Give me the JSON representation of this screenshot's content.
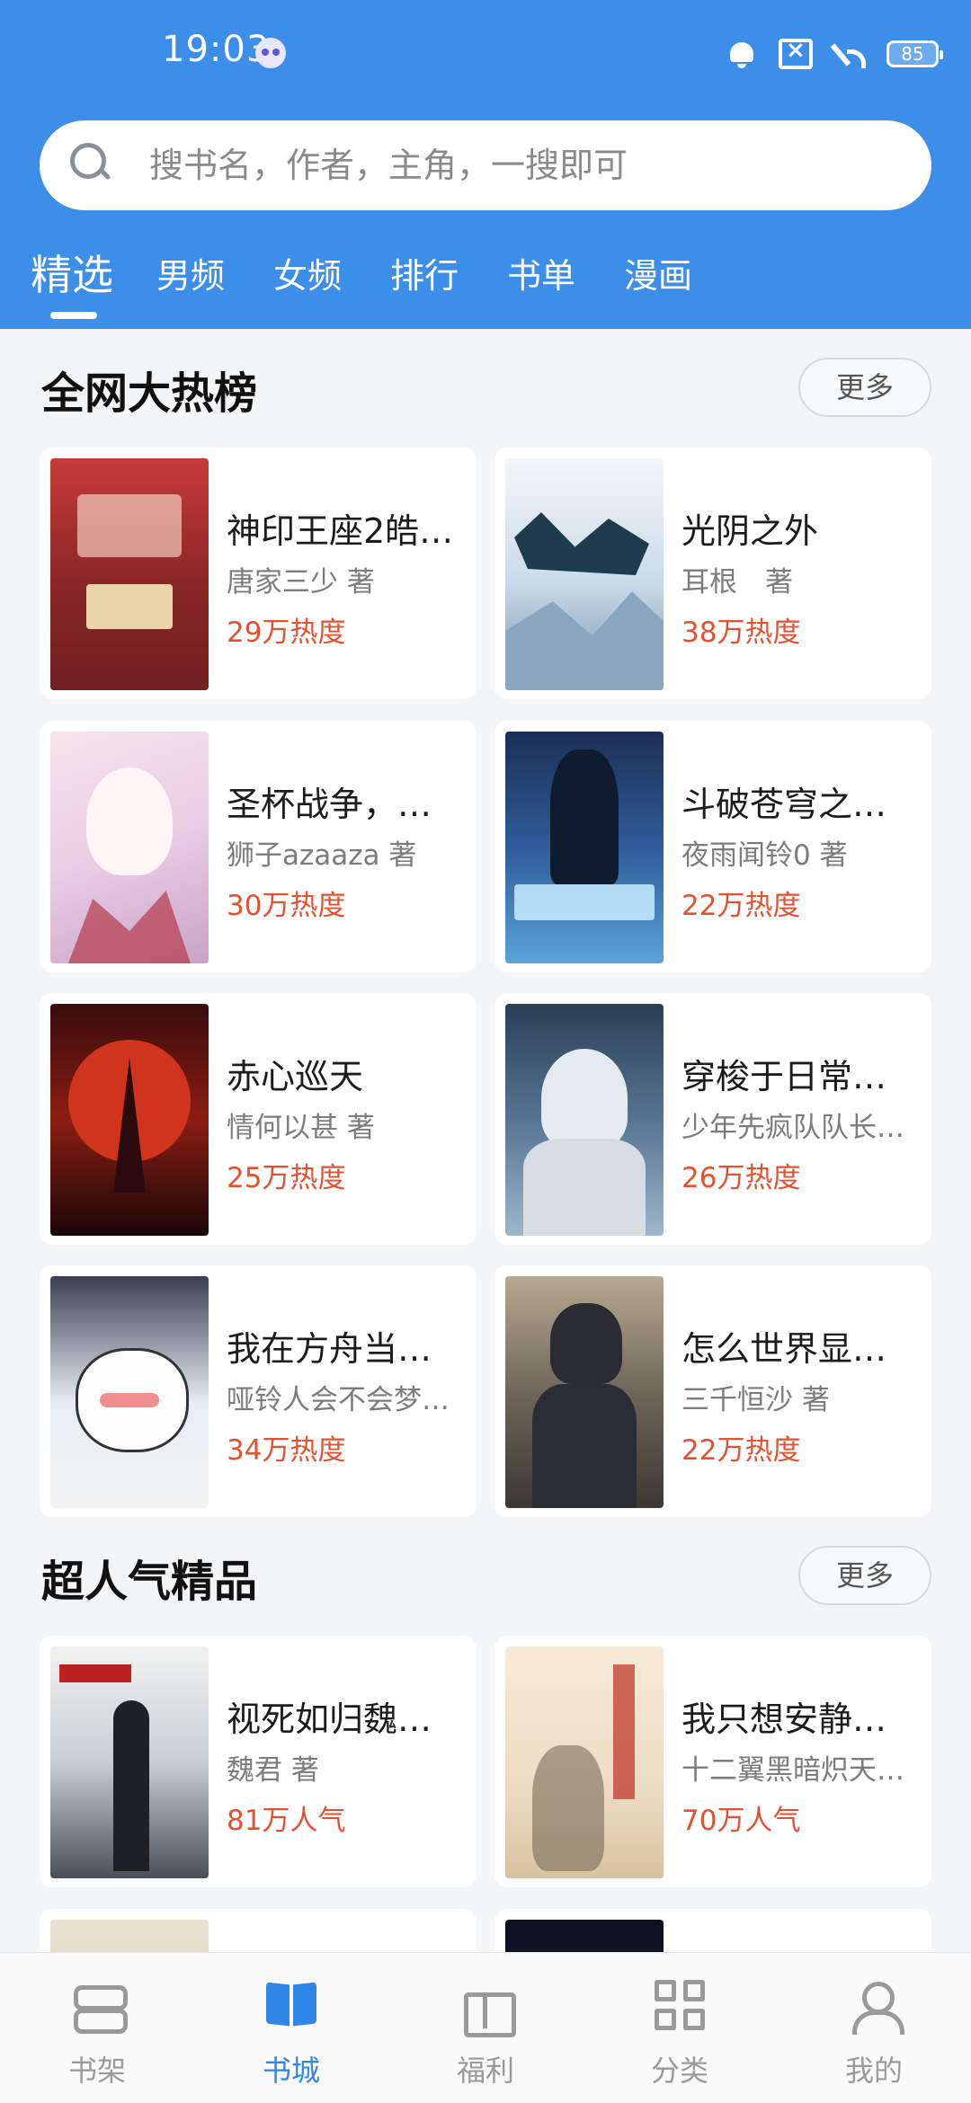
{
  "status_bar": {
    "time": "19:03",
    "battery": "85"
  },
  "search": {
    "placeholder": "搜书名，作者，主角，一搜即可"
  },
  "tabs": [
    "精选",
    "男频",
    "女频",
    "排行",
    "书单",
    "漫画"
  ],
  "sections": [
    {
      "title": "全网大热榜",
      "more_label": "更多",
      "books": [
        {
          "title": "神印王座2皓…",
          "author": "唐家三少 著",
          "stat": "29万热度"
        },
        {
          "title": "光阴之外",
          "author": "耳根　著",
          "stat": "38万热度"
        },
        {
          "title": "圣杯战争，…",
          "author": "狮子azaaza 著",
          "stat": "30万热度"
        },
        {
          "title": "斗破苍穹之…",
          "author": "夜雨闻铃0 著",
          "stat": "22万热度"
        },
        {
          "title": "赤心巡天",
          "author": "情何以甚 著",
          "stat": "25万热度"
        },
        {
          "title": "穿梭于日常…",
          "author": "少年先疯队队长…",
          "stat": "26万热度"
        },
        {
          "title": "我在方舟当…",
          "author": "哑铃人会不会梦…",
          "stat": "34万热度"
        },
        {
          "title": "怎么世界显…",
          "author": "三千恒沙 著",
          "stat": "22万热度"
        }
      ]
    },
    {
      "title": "超人气精品",
      "more_label": "更多",
      "books": [
        {
          "title": "视死如归魏…",
          "author": "魏君 著",
          "stat": "81万人气"
        },
        {
          "title": "我只想安静…",
          "author": "十二翼黑暗炽天…",
          "stat": "70万人气"
        }
      ]
    }
  ],
  "bottom_nav": [
    {
      "label": "书架",
      "icon": "bookshelf-icon"
    },
    {
      "label": "书城",
      "icon": "open-book-icon"
    },
    {
      "label": "福利",
      "icon": "gift-icon"
    },
    {
      "label": "分类",
      "icon": "category-grid-icon"
    },
    {
      "label": "我的",
      "icon": "user-icon"
    }
  ],
  "colors": {
    "header_blue": "#3d8ee8",
    "heat_red": "#e5512f",
    "nav_active": "#2f86e6"
  }
}
